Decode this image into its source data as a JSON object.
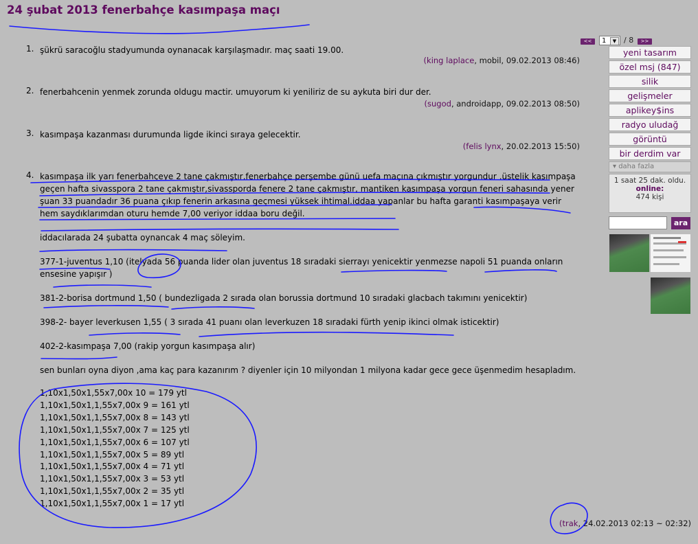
{
  "title": "24 şubat 2013 fenerbahçe kasımpaşa maçı",
  "pager": {
    "prev": "<<",
    "current": "1",
    "total": "/ 8",
    "next": ">>"
  },
  "entries": [
    {
      "num": "1.",
      "paragraphs": [
        "şükrü saracoğlu stadyumunda oynanacak karşılaşmadır. maç saati 19.00."
      ],
      "author": "king laplace",
      "meta": ", mobil, 09.02.2013 08:46)"
    },
    {
      "num": "2.",
      "paragraphs": [
        "fenerbahcenin yenmek zorunda oldugu mactir. umuyorum ki yeniliriz de su aykuta biri dur der."
      ],
      "author": "sugod",
      "meta": ", androidapp, 09.02.2013 08:50)"
    },
    {
      "num": "3.",
      "paragraphs": [
        "kasımpaşa kazanması durumunda ligde ikinci sıraya gelecektir."
      ],
      "author": "felis lynx",
      "meta": ", 20.02.2013 15:50)"
    },
    {
      "num": "4.",
      "paragraphs": [
        "kasımpaşa ilk yarı fenerbahçeye 2 tane çakmıştır,fenerbahçe perşembe günü uefa maçına çıkmıştır yorgundur ,üstelik kasımpaşa geçen hafta sivasspora 2 tane çakmıştır,sivassporda fenere 2 tane çakmıştır, mantiken kasımpaşa yorgun feneri sahasında yener şuan 33 puandadır 36 puana çıkıp fenerin arkasına geçmesi yüksek ihtimal.iddaa yapanlar bu hafta garanti kasımpaşaya verir hem saydıklarımdan oturu hemde 7,00 veriyor iddaa boru değil.",
        "iddacılarada 24 şubatta oynancak 4 maç söleyim.",
        "377-1-juventus 1,10 (itelyada 56 puanda lider olan juventus 18 sıradaki sierrayı yenicektir yenmezse napoli 51 puanda onların ensesine yapışır )",
        "381-2-borisa dortmund 1,50 ( bundezligada 2 sırada olan borussia dortmund 10 sıradaki glacbach takımını yenicektir)",
        "398-2- bayer leverkusen 1,55 ( 3 sırada 41 puanı olan leverkuzen 18 sıradaki fürth yenip ikinci olmak isticektir)",
        "402-2-kasımpaşa 7,00 (rakip yorgun kasımpaşa alır)",
        "sen bunları oyna diyon ,ama kaç para kazanırım ? diyenler için 10 milyondan 1 milyona kadar gece gece üşenmedim hesapladım."
      ],
      "math": [
        "1,10x1,50x1,55x7,00x 10 = 179 ytl",
        "1,10x1,50x1,1,55x7,00x 9 = 161 ytl",
        "1,10x1,50x1,1,55x7,00x 8 = 143 ytl",
        "1,10x1,50x1,1,55x7,00x 7 = 125 ytl",
        "1,10x1,50x1,1,55x7,00x 6 = 107 ytl",
        "1,10x1,50x1,1,55x7,00x 5 = 89 ytl",
        "1,10x1,50x1,1,55x7,00x 4 = 71 ytl",
        "1,10x1,50x1,1,55x7,00x 3 = 53 ytl",
        "1,10x1,50x1,1,55x7,00x 2 = 35 ytl",
        "1,10x1,50x1,1,55x7,00x 1 = 17 ytl"
      ],
      "author": "trak",
      "meta": ", 24.02.2013 02:13 ~ 02:32)"
    }
  ],
  "sidebar": {
    "buttons": [
      "yeni tasarım",
      "özel msj (847)",
      "silik",
      "gelişmeler",
      "aplikey$ins",
      "radyo uludağ",
      "görüntü",
      "bir derdim var"
    ],
    "more": "▾ daha fazla",
    "status_time": "1 saat 25 dak. oldu.",
    "online_label": "online:",
    "online_count": "474 kişi",
    "search_button": "ara"
  },
  "colors": {
    "accent": "#5e0a5e",
    "button": "#6b246e",
    "background": "#bdbdbd",
    "annotation": "#1a1aff"
  }
}
